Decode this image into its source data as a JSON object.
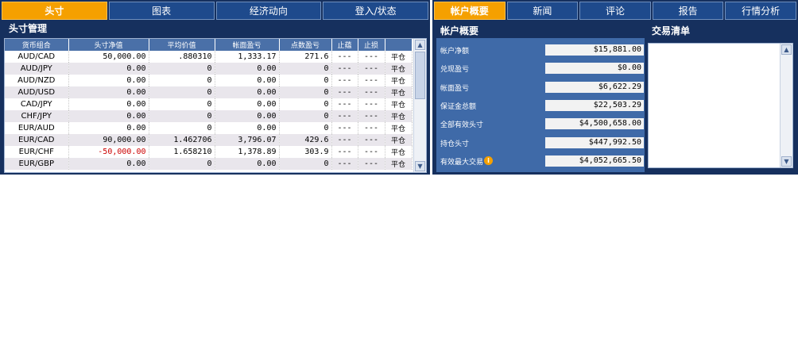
{
  "left_tabs": [
    "头寸",
    "图表",
    "经济动向",
    "登入/状态"
  ],
  "positions": {
    "title": "头寸管理",
    "columns": [
      "货币组合",
      "头寸净值",
      "平均价值",
      "帐面盈亏",
      "点数盈亏",
      "止蕴",
      "止损",
      ""
    ],
    "rows": [
      [
        "AUD/CAD",
        "50,000.00",
        ".880310",
        "1,333.17",
        "271.6",
        "---",
        "---",
        "平仓"
      ],
      [
        "AUD/JPY",
        "0.00",
        "0",
        "0.00",
        "0",
        "---",
        "---",
        "平仓"
      ],
      [
        "AUD/NZD",
        "0.00",
        "0",
        "0.00",
        "0",
        "---",
        "---",
        "平仓"
      ],
      [
        "AUD/USD",
        "0.00",
        "0",
        "0.00",
        "0",
        "---",
        "---",
        "平仓"
      ],
      [
        "CAD/JPY",
        "0.00",
        "0",
        "0.00",
        "0",
        "---",
        "---",
        "平仓"
      ],
      [
        "CHF/JPY",
        "0.00",
        "0",
        "0.00",
        "0",
        "---",
        "---",
        "平仓"
      ],
      [
        "EUR/AUD",
        "0.00",
        "0",
        "0.00",
        "0",
        "---",
        "---",
        "平仓"
      ],
      [
        "EUR/CAD",
        "90,000.00",
        "1.462706",
        "3,796.07",
        "429.6",
        "---",
        "---",
        "平仓"
      ],
      [
        "EUR/CHF",
        "-50,000.00",
        "1.658210",
        "1,378.89",
        "303.9",
        "---",
        "---",
        "平仓"
      ],
      [
        "EUR/GBP",
        "0.00",
        "0",
        "0.00",
        "0",
        "---",
        "---",
        "平仓"
      ]
    ],
    "negative_color": "#cc0000"
  },
  "right_tabs": [
    "帐户概要",
    "新闻",
    "评论",
    "报告",
    "行情分析"
  ],
  "account_summary": {
    "title": "帐户概要",
    "items": [
      {
        "label": "帐户净额",
        "value": "$15,881.00"
      },
      {
        "label": "兑现盈亏",
        "value": "$0.00"
      },
      {
        "label": "帐面盈亏",
        "value": "$6,622.29"
      },
      {
        "label": "保证金总额",
        "value": "$22,503.29"
      },
      {
        "label": "全部有效头寸",
        "value": "$4,500,658.00"
      },
      {
        "label": "持仓头寸",
        "value": "$447,992.50"
      },
      {
        "label": "有效最大交易",
        "value": "$4,052,665.50"
      }
    ]
  },
  "trade_list": {
    "title": "交易清单"
  },
  "icons": {
    "info": "info-icon",
    "scroll_up": "arrow-up-icon",
    "scroll_down": "arrow-down-icon"
  },
  "colors": {
    "accent": "#f5a000",
    "frame": "#16305e",
    "tab": "#1e4a8c",
    "header": "#4a70a8"
  }
}
